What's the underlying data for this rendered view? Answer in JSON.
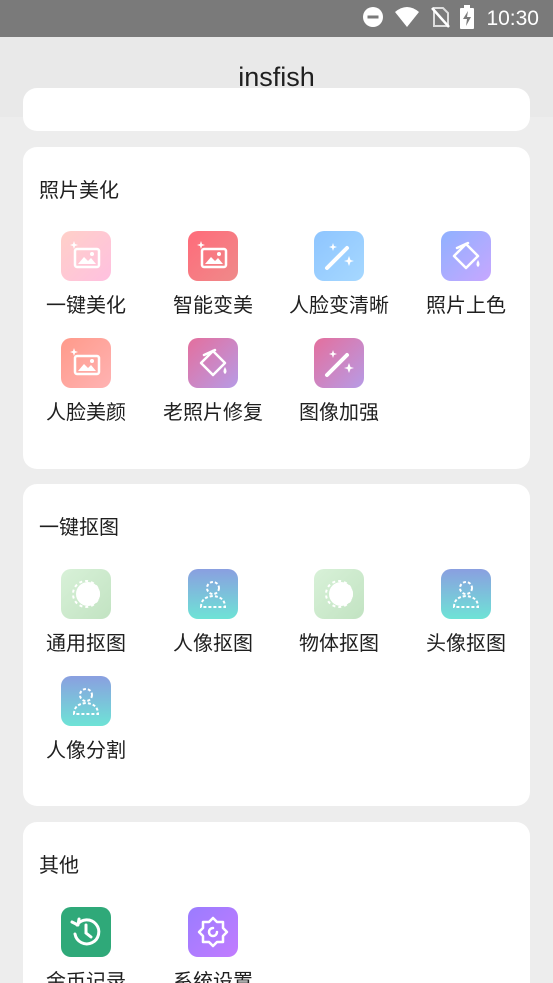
{
  "status_bar": {
    "time": "10:30"
  },
  "app_bar": {
    "title": "insfish"
  },
  "sections": [
    {
      "title": "照片美化",
      "items": [
        {
          "label": "一键美化",
          "icon": "photo-sparkle-icon"
        },
        {
          "label": "智能变美",
          "icon": "photo-sparkle-icon"
        },
        {
          "label": "人脸变清晰",
          "icon": "magic-wand-icon"
        },
        {
          "label": "照片上色",
          "icon": "paint-bucket-icon"
        },
        {
          "label": "人脸美颜",
          "icon": "photo-sparkle-icon"
        },
        {
          "label": "老照片修复",
          "icon": "paint-bucket-icon"
        },
        {
          "label": "图像加强",
          "icon": "magic-wand-icon"
        }
      ]
    },
    {
      "title": "一键抠图",
      "items": [
        {
          "label": "通用抠图",
          "icon": "circle-cutout-icon"
        },
        {
          "label": "人像抠图",
          "icon": "person-cutout-icon"
        },
        {
          "label": "物体抠图",
          "icon": "circle-cutout-icon"
        },
        {
          "label": "头像抠图",
          "icon": "person-cutout-icon"
        },
        {
          "label": "人像分割",
          "icon": "person-cutout-icon"
        }
      ]
    },
    {
      "title": "其他",
      "items": [
        {
          "label": "金币记录",
          "icon": "history-clock-icon"
        },
        {
          "label": "系统设置",
          "icon": "gear-icon"
        }
      ]
    }
  ]
}
